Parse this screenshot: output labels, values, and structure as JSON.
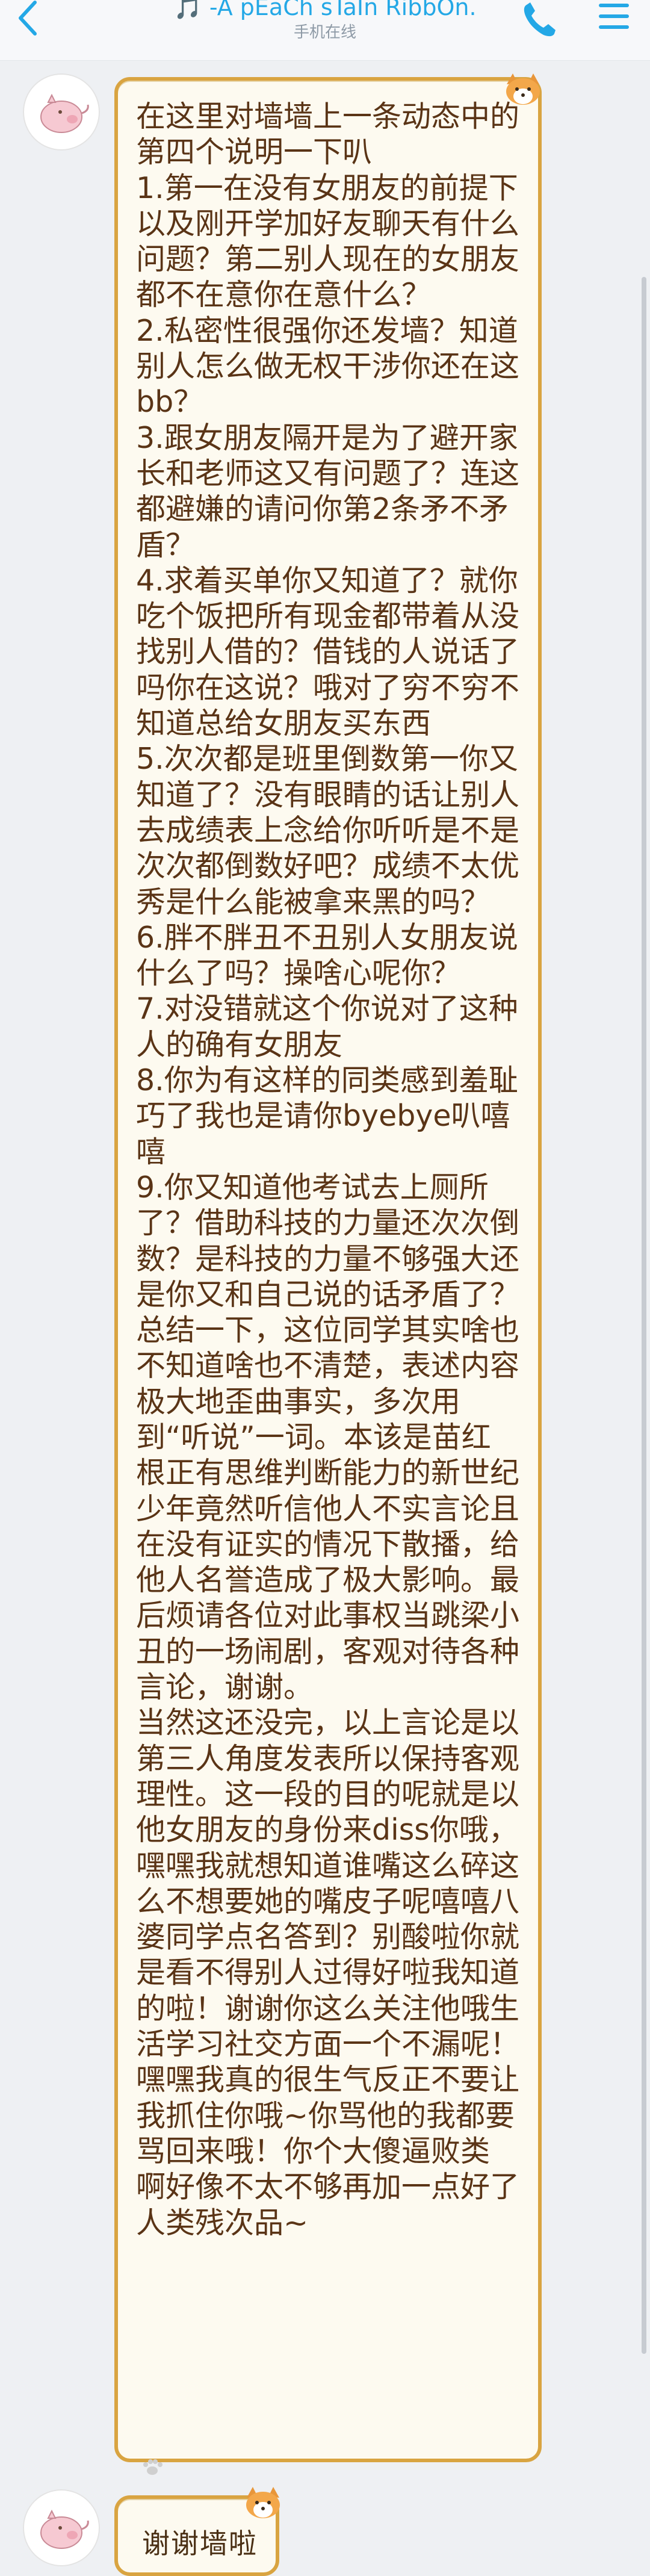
{
  "header": {
    "title": "🎵 -A pEaCh sTaIn RibbOn.",
    "subtitle": "手机在线",
    "icons": [
      "back-chevron-icon",
      "phone-icon",
      "menu-icon"
    ],
    "accent_color": "#24a8e6"
  },
  "messages": [
    {
      "text": "在这里对墙墙上一条动态中的第四个说明一下叭\n1.第一在没有女朋友的前提下以及刚开学加好友聊天有什么问题？第二别人现在的女朋友都不在意你在意什么？\n2.私密性很强你还发墙？知道别人怎么做无权干涉你还在这bb？\n3.跟女朋友隔开是为了避开家长和老师这又有问题了？连这都避嫌的请问你第2条矛不矛盾？\n4.求着买单你又知道了？就你吃个饭把所有现金都带着从没找别人借的？借钱的人说话了吗你在这说？哦对了穷不穷不知道总给女朋友买东西\n5.次次都是班里倒数第一你又知道了？没有眼睛的话让别人去成绩表上念给你听听是不是次次都倒数好吧？成绩不太优秀是什么能被拿来黑的吗？\n6.胖不胖丑不丑别人女朋友说什么了吗？操啥心呢你？\n7.对没错就这个你说对了这种人的确有女朋友\n8.你为有这样的同类感到羞耻巧了我也是请你byebye叭嘻嘻\n9.你又知道他考试去上厕所了？借助科技的力量还次次倒数？是科技的力量不够强大还是你又和自己说的话矛盾了？\n总结一下，这位同学其实啥也不知道啥也不清楚，表述内容极大地歪曲事实，多次用到“听说”一词。本该是苗红根正有思维判断能力的新世纪少年竟然听信他人不实言论且在没有证实的情况下散播，给他人名誉造成了极大影响。最后烦请各位对此事权当跳梁小丑的一场闹剧，客观对待各种言论，谢谢。\n当然这还没完，以上言论是以第三人角度发表所以保持客观理性。这一段的目的呢就是以他女朋友的身份来diss你哦，嘿嘿我就想知道谁嘴这么碎这么不想要她的嘴皮子呢嘻嘻八婆同学点名答到？别酸啦你就是看不得别人过得好啦我知道的啦！谢谢你这么关注他哦生活学习社交方面一个不漏呢！嘿嘿我真的很生气反正不要让我抓住你哦~你骂他的我都要骂回来哦！你个大傻逼败类 啊好像不太不够再加一点好了 人类残次品~"
    },
    {
      "text": "谢谢墙啦"
    }
  ],
  "theme": {
    "bubble_border": "#d9a441",
    "bubble_bg": "#fdfaf0",
    "text_color": "#5a3416"
  }
}
